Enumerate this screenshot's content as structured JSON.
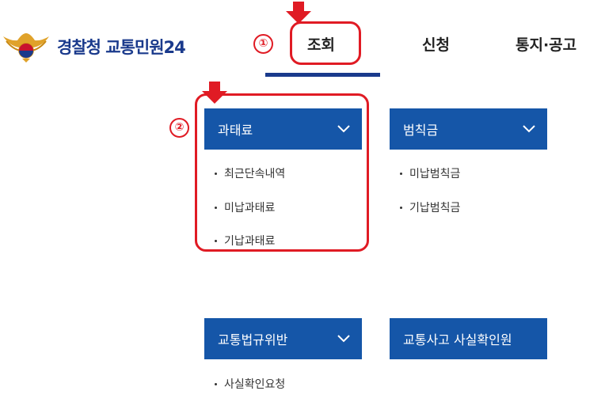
{
  "header": {
    "brand": "경찰청 교통민원24",
    "logo_icon": "police-emblem-icon",
    "tabs": [
      {
        "label": "조회",
        "active": true
      },
      {
        "label": "신청",
        "active": false
      },
      {
        "label": "통지·공고",
        "active": false
      }
    ]
  },
  "menu": {
    "groups": [
      {
        "title": "과태료",
        "items": [
          "최근단속내역",
          "미납과태료",
          "기납과태료"
        ]
      },
      {
        "title": "범칙금",
        "items": [
          "미납범칙금",
          "기납범칙금"
        ]
      },
      {
        "title": "교통법규위반",
        "items": [
          "사실확인요청"
        ]
      },
      {
        "title": "교통사고 사실확인원",
        "items": []
      }
    ]
  },
  "annotations": {
    "step1": "①",
    "step2": "②"
  },
  "colors": {
    "brand": "#1a3a8c",
    "menu_bg": "#1556a8",
    "annotation": "#e01b24"
  }
}
